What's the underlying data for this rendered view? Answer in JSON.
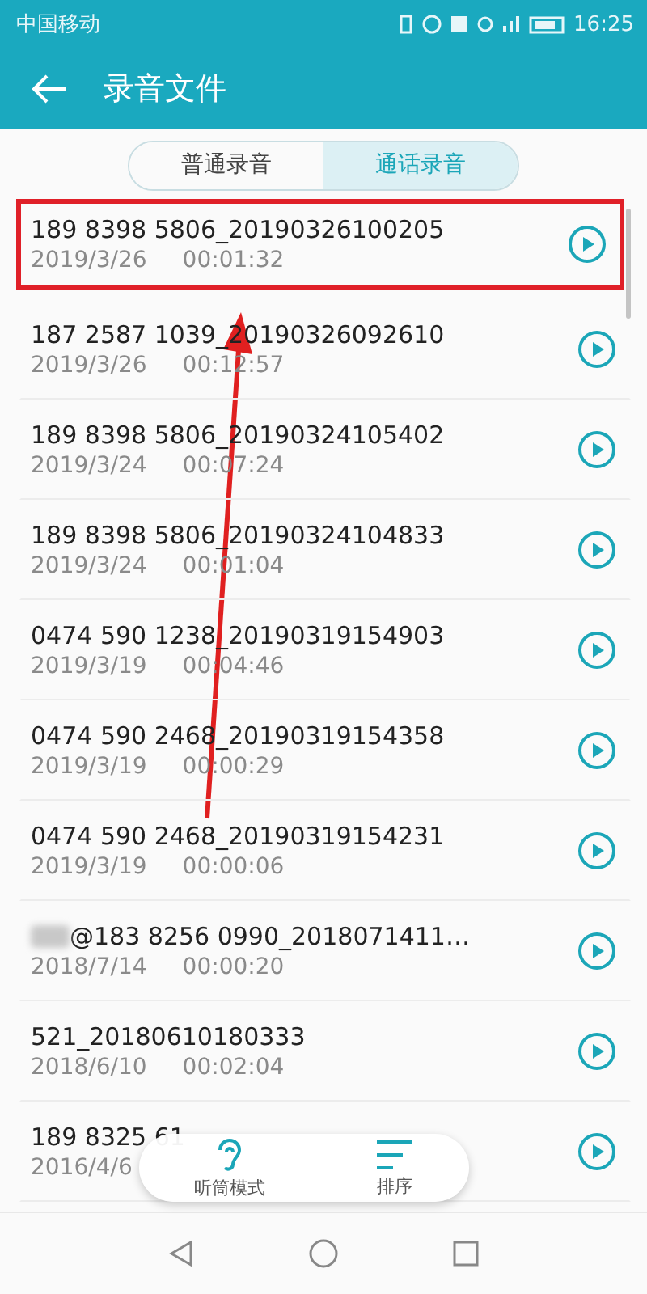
{
  "status_bar": {
    "carrier": "中国移动",
    "time": "16:25"
  },
  "app_bar": {
    "title": "录音文件"
  },
  "tabs": [
    {
      "label": "普通录音",
      "selected": false
    },
    {
      "label": "通话录音",
      "selected": true
    }
  ],
  "recordings": [
    {
      "name": "189 8398 5806_20190326100205",
      "date": "2019/3/26",
      "duration": "00:01:32",
      "highlighted": true
    },
    {
      "name": "187 2587 1039_20190326092610",
      "date": "2019/3/26",
      "duration": "00:12:57",
      "highlighted": false
    },
    {
      "name": "189 8398 5806_20190324105402",
      "date": "2019/3/24",
      "duration": "00:07:24",
      "highlighted": false
    },
    {
      "name": "189 8398 5806_20190324104833",
      "date": "2019/3/24",
      "duration": "00:01:04",
      "highlighted": false
    },
    {
      "name": "0474 590 1238_20190319154903",
      "date": "2019/3/19",
      "duration": "00:04:46",
      "highlighted": false
    },
    {
      "name": "0474 590 2468_20190319154358",
      "date": "2019/3/19",
      "duration": "00:00:29",
      "highlighted": false
    },
    {
      "name": "0474 590 2468_20190319154231",
      "date": "2019/3/19",
      "duration": "00:00:06",
      "highlighted": false
    },
    {
      "name": "@183 8256 0990_2018071411…",
      "date": "2018/7/14",
      "duration": "00:00:20",
      "highlighted": false,
      "redacted_prefix": true
    },
    {
      "name": "521_20180610180333",
      "date": "2018/6/10",
      "duration": "00:02:04",
      "highlighted": false
    },
    {
      "name": "189 8325 61",
      "date": "2016/4/6",
      "highlighted": false
    }
  ],
  "bottom_actions": [
    {
      "label": "听筒模式",
      "kind": "ear"
    },
    {
      "label": "排序",
      "kind": "sort"
    }
  ]
}
